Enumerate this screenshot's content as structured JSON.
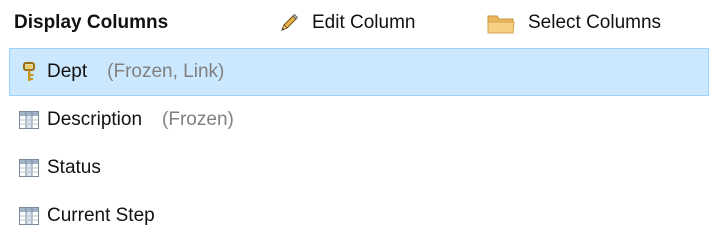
{
  "header": {
    "title": "Display Columns",
    "edit_label": "Edit Column",
    "select_label": "Select Columns"
  },
  "columns": [
    {
      "name": "Dept",
      "note": "(Frozen, Link)",
      "icon": "key-icon",
      "selected": true
    },
    {
      "name": "Description",
      "note": "(Frozen)",
      "icon": "column-icon",
      "selected": false
    },
    {
      "name": "Status",
      "note": "",
      "icon": "column-icon",
      "selected": false
    },
    {
      "name": "Current Step",
      "note": "",
      "icon": "column-icon",
      "selected": false
    }
  ],
  "colors": {
    "selection_bg": "#cce8ff",
    "selection_border": "#99d1ff",
    "note_text": "#808080",
    "folder": "#f5c97a",
    "key": "#c8961e"
  }
}
